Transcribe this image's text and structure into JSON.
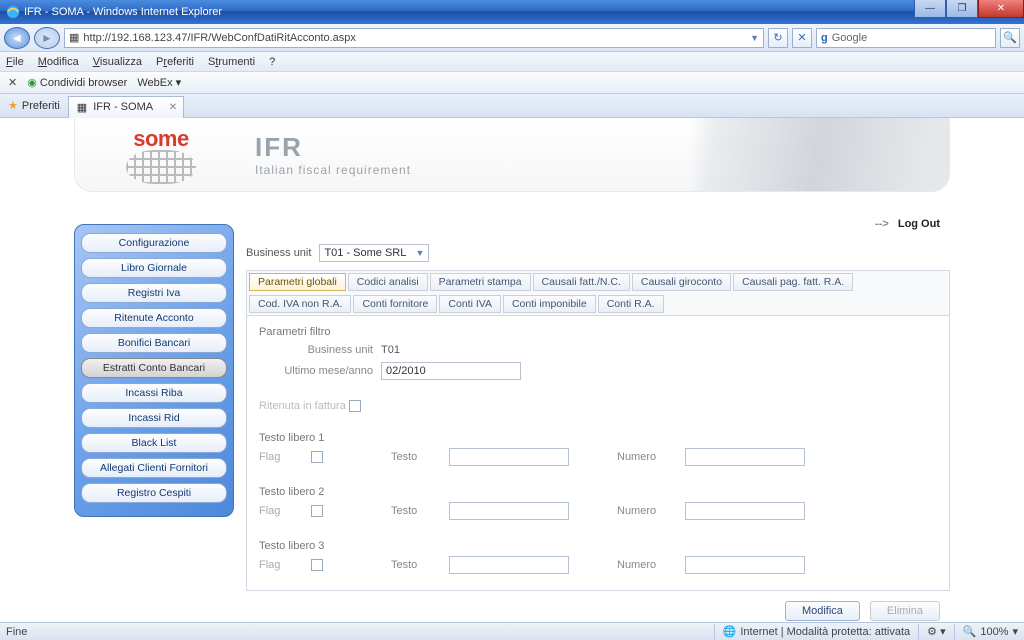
{
  "window": {
    "title": "IFR - SOMA - Windows Internet Explorer"
  },
  "addr": {
    "url": "http://192.168.123.47/IFR/WebConfDatiRitAcconto.aspx",
    "search_engine": "Google"
  },
  "menu": {
    "file": "File",
    "edit": "Modifica",
    "view": "Visualizza",
    "fav": "Preferiti",
    "tools": "Strumenti",
    "help": "?"
  },
  "toolbar": {
    "share": "Condividi browser",
    "webex": "WebEx"
  },
  "favtab": {
    "fav_label": "Preferiti",
    "tab_label": "IFR - SOMA"
  },
  "header": {
    "logo": "some",
    "ifr": "IFR",
    "sub": "Italian fiscal requirement"
  },
  "logout": {
    "arrow": "-->",
    "label": "Log Out"
  },
  "bu": {
    "label": "Business unit",
    "selected": "T01 - Some SRL"
  },
  "sidebar": {
    "items": [
      {
        "label": "Configurazione"
      },
      {
        "label": "Libro Giornale"
      },
      {
        "label": "Registri Iva"
      },
      {
        "label": "Ritenute Acconto"
      },
      {
        "label": "Bonifici Bancari"
      },
      {
        "label": "Estratti Conto Bancari"
      },
      {
        "label": "Incassi Riba"
      },
      {
        "label": "Incassi Rid"
      },
      {
        "label": "Black List"
      },
      {
        "label": "Allegati Clienti Fornitori"
      },
      {
        "label": "Registro Cespiti"
      }
    ]
  },
  "tabs": {
    "r1": [
      {
        "label": "Parametri globali",
        "sel": true
      },
      {
        "label": "Codici analisi"
      },
      {
        "label": "Parametri stampa"
      },
      {
        "label": "Causali fatt./N.C."
      },
      {
        "label": "Causali giroconto"
      },
      {
        "label": "Causali pag. fatt. R.A."
      }
    ],
    "r2": [
      {
        "label": "Cod. IVA non R.A."
      },
      {
        "label": "Conti fornitore"
      },
      {
        "label": "Conti IVA"
      },
      {
        "label": "Conti imponibile"
      },
      {
        "label": "Conti R.A."
      }
    ]
  },
  "form": {
    "filter_title": "Parametri filtro",
    "bu_label": "Business unit",
    "bu_value": "T01",
    "month_label": "Ultimo mese/anno",
    "month_value": "02/2010",
    "rit_label": "Ritenuta in fattura",
    "tl": [
      {
        "title": "Testo libero 1"
      },
      {
        "title": "Testo libero 2"
      },
      {
        "title": "Testo libero 3"
      }
    ],
    "flag": "Flag",
    "testo": "Testo",
    "numero": "Numero",
    "modify": "Modifica",
    "delete": "Elimina"
  },
  "status": {
    "left": "Fine",
    "zone": "Internet | Modalità protetta: attivata",
    "zoom": "100%"
  }
}
